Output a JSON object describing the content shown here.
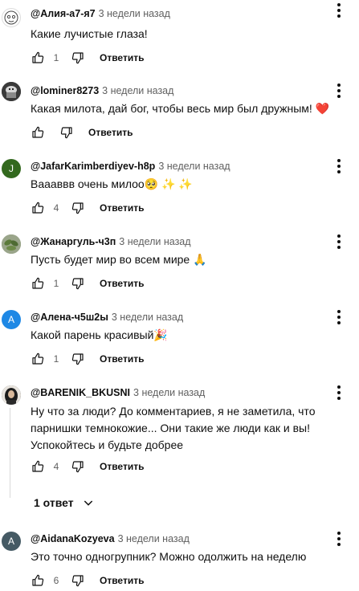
{
  "comments": [
    {
      "author": "@Алия-а7-я7",
      "time": "3 недели назад",
      "text": "Какие лучистые глаза!",
      "likes": "1",
      "reply": "Ответить",
      "avatar": "sketch-face-avatar",
      "avatar_letter": "",
      "avatar_color": "#ffffff"
    },
    {
      "author": "@lominer8273",
      "time": "3 недели назад",
      "text": "Какая милота, дай бог, чтобы весь мир был дружным! ❤️",
      "likes": "",
      "reply": "Ответить",
      "avatar": "game-character-avatar",
      "avatar_letter": "",
      "avatar_color": "#3a3a3a"
    },
    {
      "author": "@JafarKarimberdiyev-h8p",
      "time": "3 недели назад",
      "text": "Ваааввв очень милоо🥺 ✨ ✨",
      "likes": "4",
      "reply": "Ответить",
      "avatar": "letter-avatar",
      "avatar_letter": "J",
      "avatar_color": "#33691e"
    },
    {
      "author": "@Жанаргуль-ч3п",
      "time": "3 недели назад",
      "text": "Пусть будет мир во всем мире 🙏",
      "likes": "1",
      "reply": "Ответить",
      "avatar": "plant-photo-avatar",
      "avatar_letter": "",
      "avatar_color": "#7a8a6a"
    },
    {
      "author": "@Алена-ч5ш2ы",
      "time": "3 недели назад",
      "text": "Какой парень красивый🎉",
      "likes": "1",
      "reply": "Ответить",
      "avatar": "letter-avatar",
      "avatar_letter": "А",
      "avatar_color": "#1e88e5"
    },
    {
      "author": "@BARENIK_BKUSNI",
      "time": "3 недели назад",
      "text": "Ну что за люди? До комментариев, я не заметила, что парнишки темнокожие... Они такие же люди как и вы! Успокойтесь и будьте добрее",
      "likes": "4",
      "reply": "Ответить",
      "avatar": "woman-photo-avatar",
      "avatar_letter": "",
      "avatar_color": "#2b2b2b"
    },
    {
      "author": "@AidanaKozyeva",
      "time": "3 недели назад",
      "text": "Это точно одногрупник? Можно одолжить на неделю",
      "likes": "6",
      "reply": "Ответить",
      "avatar": "letter-avatar",
      "avatar_letter": "A",
      "avatar_color": "#455a64"
    }
  ],
  "replies_toggle": {
    "label": "1 ответ"
  }
}
